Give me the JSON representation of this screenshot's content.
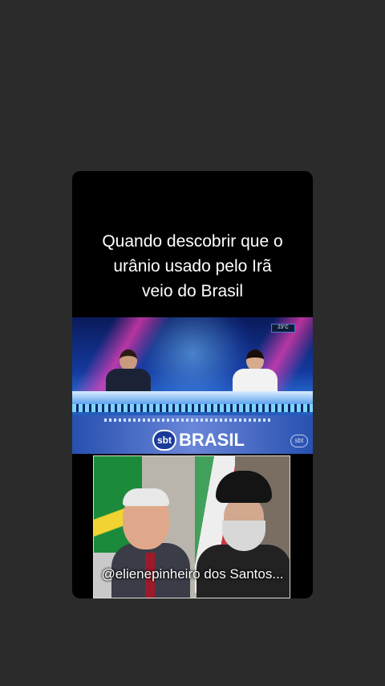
{
  "post": {
    "caption_line1": "Quando descobrir que o",
    "caption_line2": "urânio usado pelo Irã",
    "caption_line3": "veio do Brasil",
    "username_overlay": "@elienepinheiro dos Santos..."
  },
  "broadcast": {
    "logo_badge": "sbt",
    "logo_word": "BRASIL",
    "corner_bug": "sbt",
    "weather": "23°C"
  },
  "colors": {
    "background": "#2b2b2b",
    "card": "#000000",
    "studio_blue": "#2a6fd6"
  }
}
